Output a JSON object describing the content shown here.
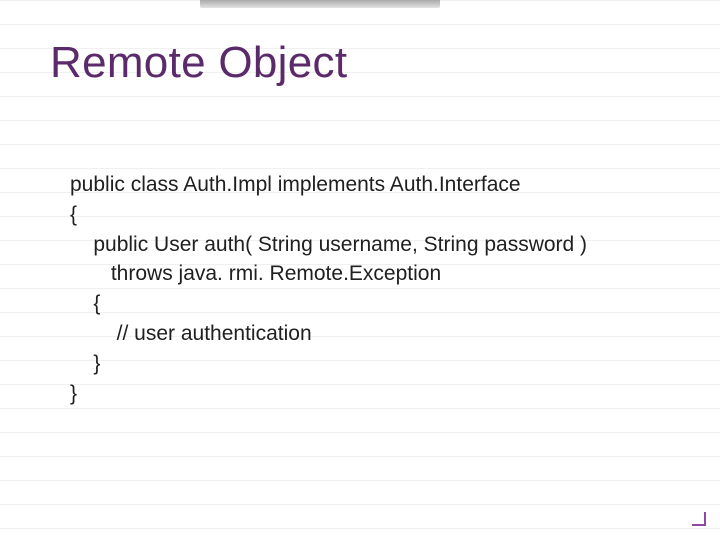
{
  "slide": {
    "title": "Remote Object",
    "code": {
      "l1": "public class Auth.Impl implements Auth.Interface",
      "l2": "{",
      "l3": "    public User auth( String username, String password )",
      "l4": "       throws java. rmi. Remote.Exception",
      "l5": "    {",
      "l6": "        // user authentication",
      "l7": "    }",
      "l8": "}"
    }
  }
}
